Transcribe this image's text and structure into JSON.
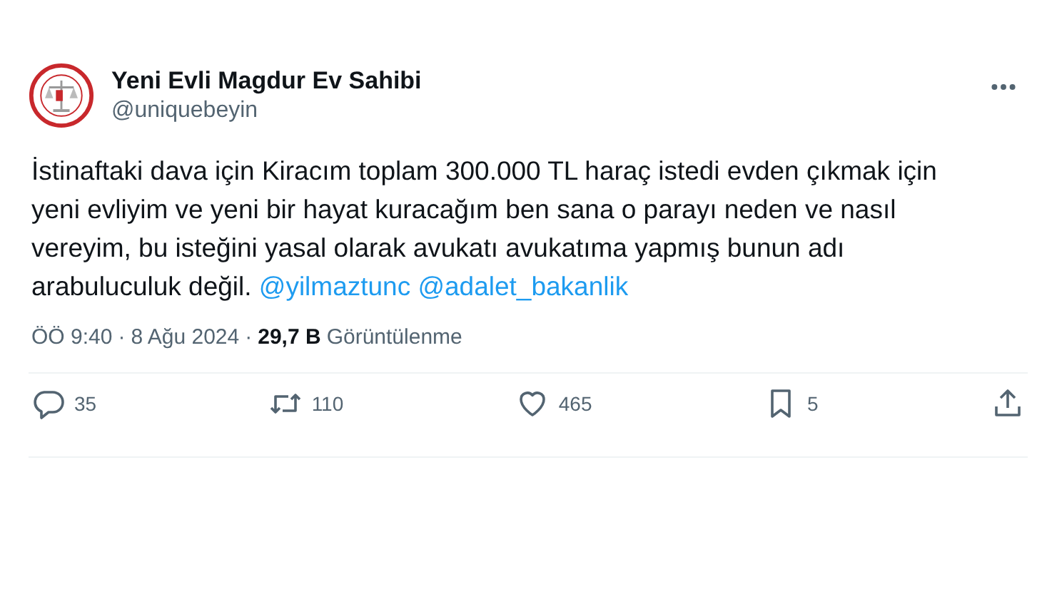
{
  "author": {
    "name": "Yeni Evli Magdur Ev Sahibi",
    "handle": "@uniquebeyin"
  },
  "body": {
    "text": "İstinaftaki dava için Kiracım toplam 300.000 TL haraç istedi evden çıkmak için yeni evliyim ve yeni bir hayat kuracağım ben sana o parayı neden ve nasıl vereyim, bu isteğini yasal olarak avukatı avukatıma yapmış bunun adı arabuluculuk değil.",
    "mentions": [
      "@yilmaztunc",
      "@adalet_bakanlik"
    ]
  },
  "meta": [
    {
      "kind": "time",
      "text": "ÖÖ 9:40"
    },
    {
      "kind": "separator",
      "text": "·"
    },
    {
      "kind": "date",
      "text": "8 Ağu 2024"
    },
    {
      "kind": "separator",
      "text": "·"
    },
    {
      "kind": "count",
      "text": "29,7 B"
    },
    {
      "kind": "label",
      "text": "Görüntülenme"
    }
  ],
  "actions": [
    {
      "kind": "reply",
      "count": "35"
    },
    {
      "kind": "repost",
      "count": "110"
    },
    {
      "kind": "like",
      "count": "465"
    },
    {
      "kind": "bookmark",
      "count": "5"
    },
    {
      "kind": "share"
    }
  ]
}
